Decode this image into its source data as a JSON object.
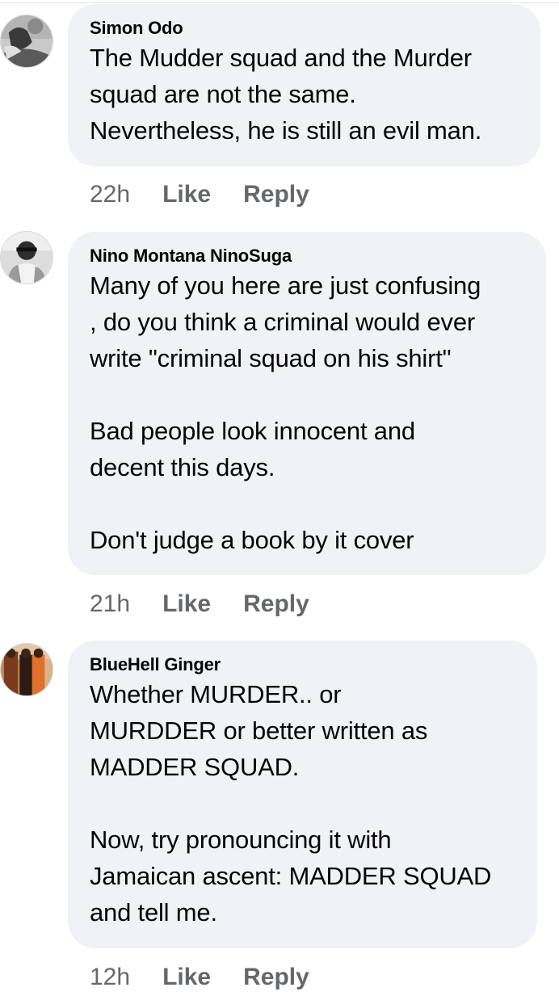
{
  "comments": [
    {
      "author": "Simon Odo",
      "text": "The Mudder squad and the Murder\nsquad are not the same.\nNevertheless, he is still an evil man.",
      "time": "22h",
      "like": "Like",
      "reply": "Reply"
    },
    {
      "author": "Nino Montana NinoSuga",
      "text": "Many of you here are just confusing\n, do you think a criminal would ever\nwrite \"criminal squad on his shirt\"\n\nBad people look innocent and\ndecent this days.\n\nDon't judge a book by it cover",
      "time": "21h",
      "like": "Like",
      "reply": "Reply"
    },
    {
      "author": "BlueHell Ginger",
      "text": "Whether MURDER.. or\nMURDDER or better written as\nMADDER SQUAD.\n\nNow, try pronouncing it with\nJamaican ascent: MADDER SQUAD\nand tell me.",
      "time": "12h",
      "like": "Like",
      "reply": "Reply"
    }
  ],
  "colors": {
    "bubble": "#f0f2f5",
    "text": "#050505",
    "meta": "#65676b"
  }
}
